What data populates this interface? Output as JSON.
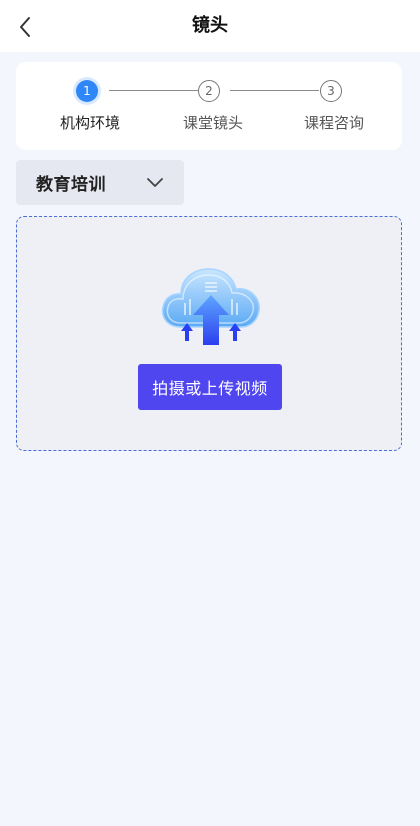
{
  "header": {
    "title": "镜头",
    "back_icon": "chevron-left-icon"
  },
  "stepper": {
    "steps": [
      {
        "number": "1",
        "label": "机构环境",
        "status": "active"
      },
      {
        "number": "2",
        "label": "课堂镜头",
        "status": "inactive"
      },
      {
        "number": "3",
        "label": "课程咨询",
        "status": "inactive"
      }
    ]
  },
  "category": {
    "selected": "教育培训",
    "icon": "chevron-down-icon"
  },
  "upload": {
    "button_label": "拍摄或上传视频",
    "icon": "cloud-upload-icon"
  },
  "colors": {
    "accent": "#2f86f6",
    "button": "#5046f0",
    "background": "#f4f6fd"
  }
}
